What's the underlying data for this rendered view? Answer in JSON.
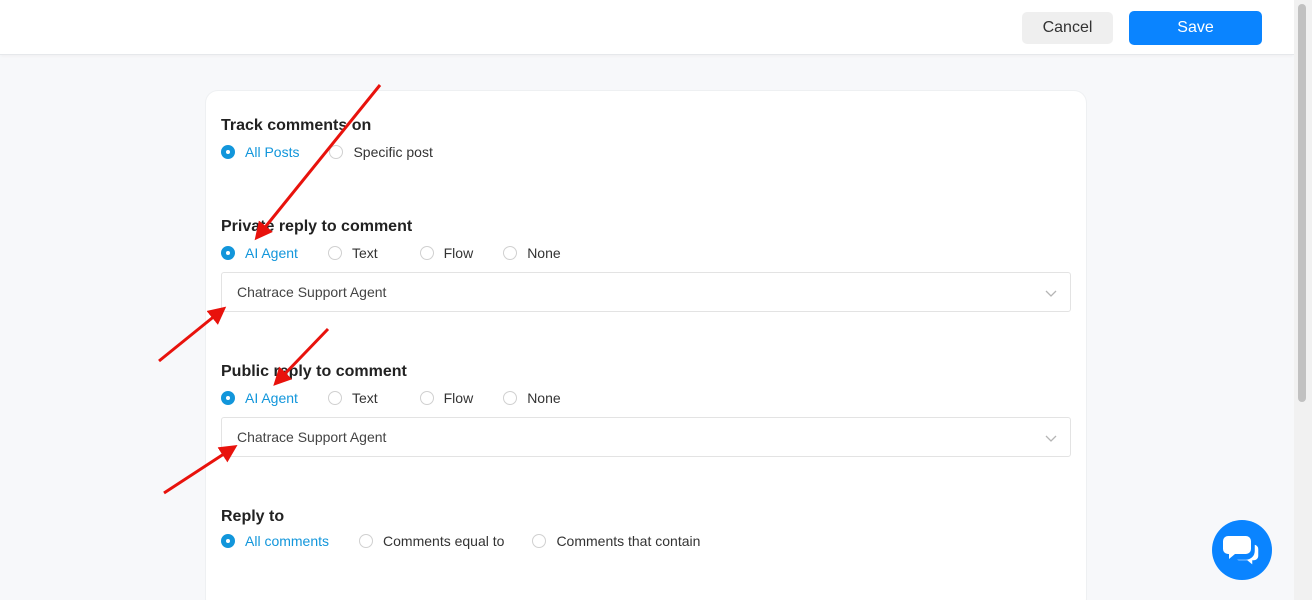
{
  "header": {
    "cancel_label": "Cancel",
    "save_label": "Save"
  },
  "track": {
    "title": "Track comments on",
    "options": [
      {
        "label": "All Posts",
        "selected": true
      },
      {
        "label": "Specific post",
        "selected": false
      }
    ]
  },
  "private_reply": {
    "title": "Private reply to comment",
    "options": [
      {
        "label": "AI Agent",
        "selected": true
      },
      {
        "label": "Text",
        "selected": false
      },
      {
        "label": "Flow",
        "selected": false
      },
      {
        "label": "None",
        "selected": false
      }
    ],
    "select_value": "Chatrace Support Agent"
  },
  "public_reply": {
    "title": "Public reply to comment",
    "options": [
      {
        "label": "AI Agent",
        "selected": true
      },
      {
        "label": "Text",
        "selected": false
      },
      {
        "label": "Flow",
        "selected": false
      },
      {
        "label": "None",
        "selected": false
      }
    ],
    "select_value": "Chatrace Support Agent"
  },
  "reply_to": {
    "title": "Reply to",
    "options": [
      {
        "label": "All comments",
        "selected": true
      },
      {
        "label": "Comments equal to",
        "selected": false
      },
      {
        "label": "Comments that contain",
        "selected": false
      }
    ]
  },
  "colors": {
    "accent": "#1296db",
    "save_button": "#0a84ff",
    "annotation_arrow": "#e8120c"
  },
  "icons": {
    "chat_fab": "chat-bubbles-icon",
    "select_chevron": "chevron-down-icon"
  }
}
